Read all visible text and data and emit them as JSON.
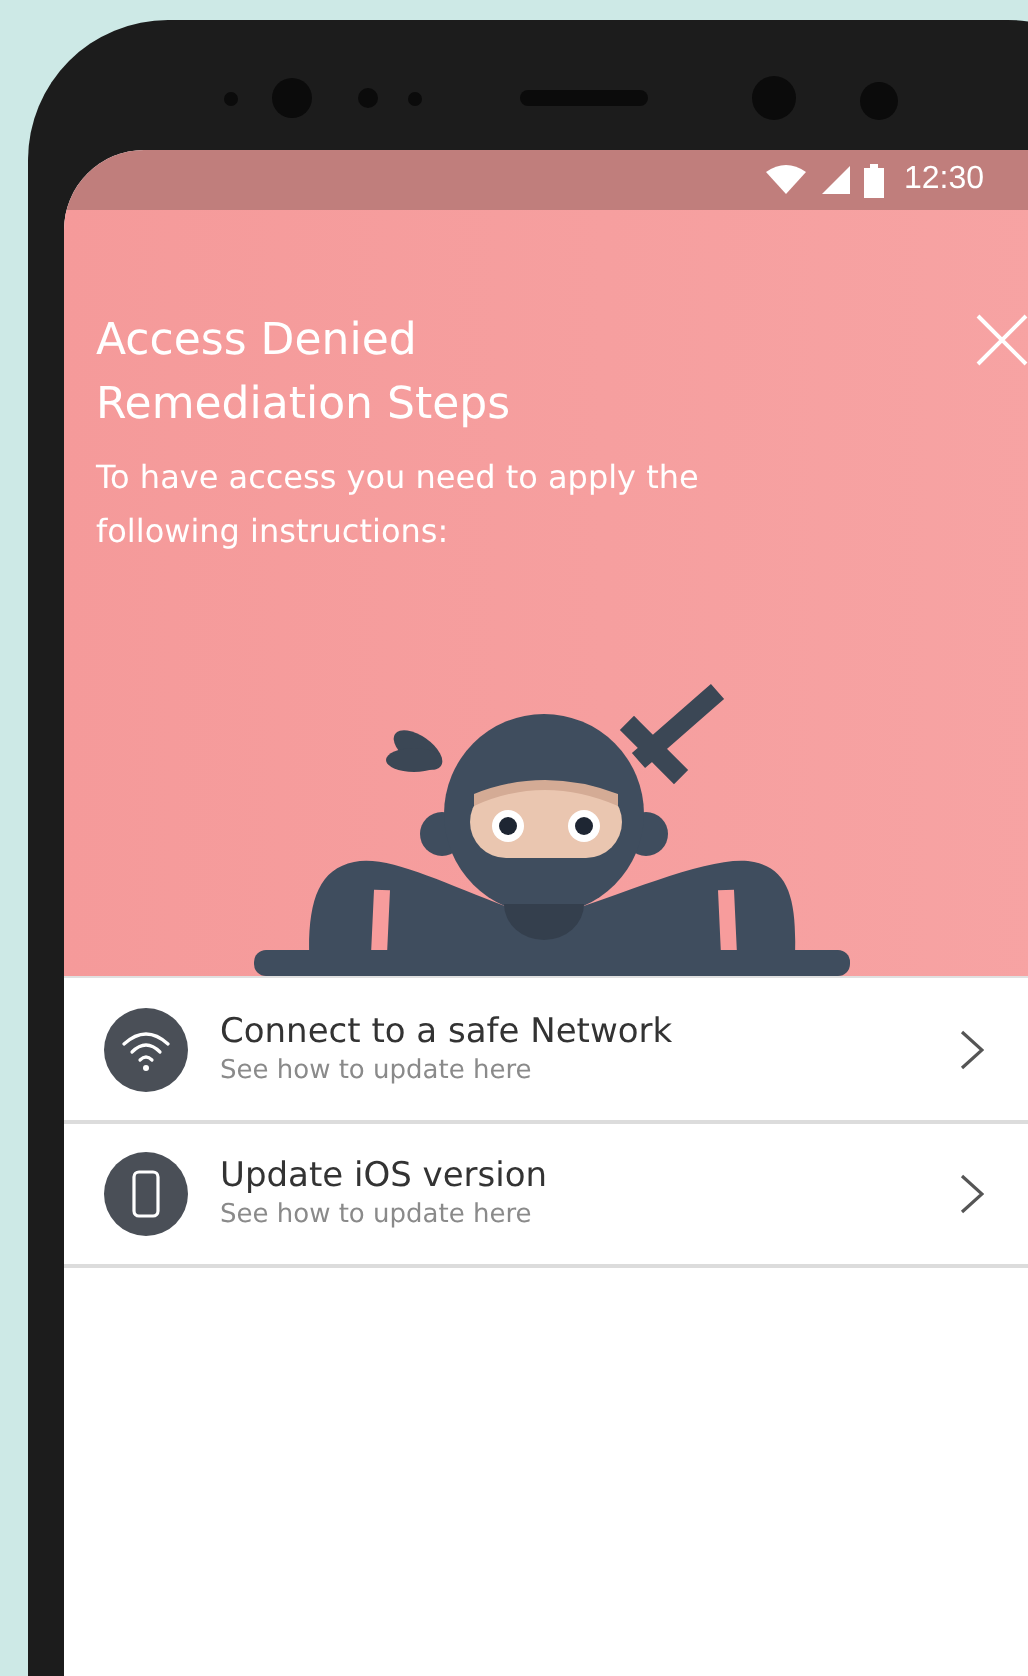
{
  "status_bar": {
    "time": "12:30"
  },
  "header": {
    "title_lines": [
      "Access Denied",
      "Remediation Steps"
    ],
    "subtitle": "To have access you need to apply the following instructions:"
  },
  "steps": [
    {
      "kind": "wifi",
      "title": "Connect to a safe Network",
      "subtitle": "See how to update here"
    },
    {
      "kind": "phone",
      "title": "Update iOS version",
      "subtitle": "See how to update here"
    }
  ]
}
